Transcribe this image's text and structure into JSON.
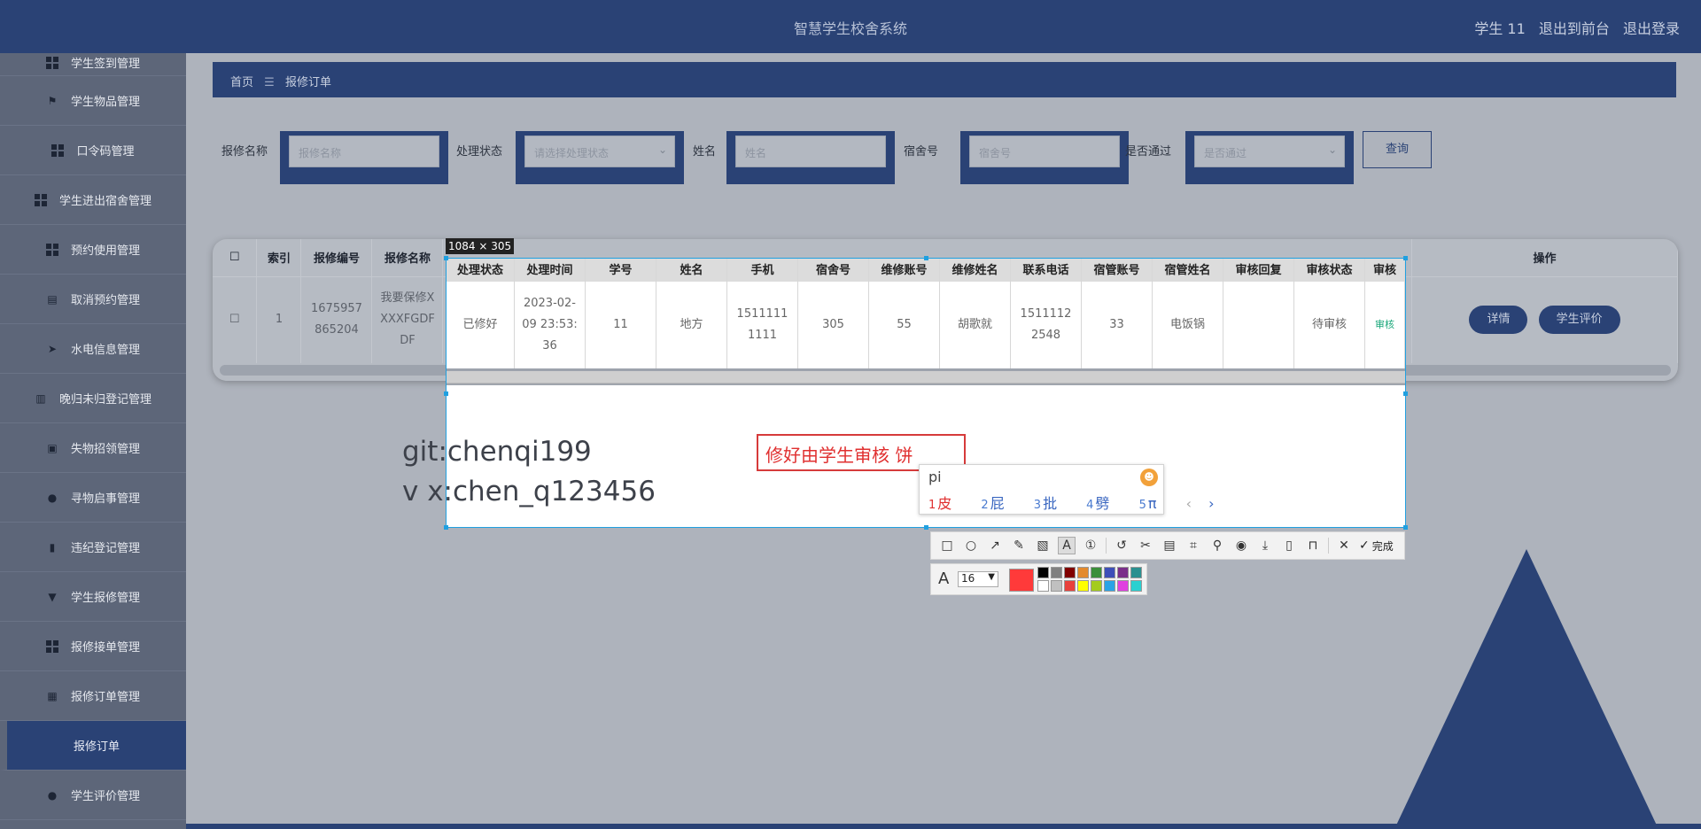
{
  "header": {
    "title": "智慧学生校舍系统",
    "user": "学生 11",
    "back_to_front": "退出到前台",
    "logout": "退出登录"
  },
  "sidebar": {
    "items": [
      {
        "label": "学生签到管理",
        "icon": "grid-icon"
      },
      {
        "label": "学生物品管理",
        "icon": "flag-icon"
      },
      {
        "label": "口令码管理",
        "icon": "grid-icon"
      },
      {
        "label": "学生进出宿舍管理",
        "icon": "grid-icon"
      },
      {
        "label": "预约使用管理",
        "icon": "grid-icon"
      },
      {
        "label": "取消预约管理",
        "icon": "clipboard-icon"
      },
      {
        "label": "水电信息管理",
        "icon": "send-icon"
      },
      {
        "label": "晚归未归登记管理",
        "icon": "book-icon"
      },
      {
        "label": "失物招领管理",
        "icon": "trash-icon"
      },
      {
        "label": "寻物启事管理",
        "icon": "user-icon"
      },
      {
        "label": "违纪登记管理",
        "icon": "bar-chart-icon"
      },
      {
        "label": "学生报修管理",
        "icon": "brush-icon"
      },
      {
        "label": "报修接单管理",
        "icon": "grid-icon"
      },
      {
        "label": "报修订单管理",
        "icon": "apps-icon"
      },
      {
        "label": "报修订单",
        "icon": ""
      },
      {
        "label": "学生评价管理",
        "icon": "user-icon"
      }
    ]
  },
  "breadcrumb": {
    "home": "首页",
    "sep": "☰",
    "current": "报修订单"
  },
  "filters": {
    "repair_name_label": "报修名称",
    "repair_name_placeholder": "报修名称",
    "status_label": "处理状态",
    "status_placeholder": "请选择处理状态",
    "name_label": "姓名",
    "name_placeholder": "姓名",
    "dorm_label": "宿舍号",
    "dorm_placeholder": "宿舍号",
    "pass_label": "是否通过",
    "pass_placeholder": "是否通过",
    "query_button": "查询"
  },
  "table": {
    "columns": [
      "索引",
      "报修编号",
      "报修名称",
      "处理状态",
      "处理时间",
      "学号",
      "姓名",
      "手机",
      "宿舍号",
      "维修账号",
      "维修姓名",
      "联系电话",
      "宿管账号",
      "宿管姓名",
      "审核回复",
      "审核状态",
      "审核",
      "操作"
    ],
    "row": {
      "index": "1",
      "repair_no": "1675957865204",
      "repair_name": "我要保修XXXXFGDF DF",
      "status": "已修好",
      "time": "2023-02-09 23:53:36",
      "student_no": "11",
      "name": "地方",
      "phone": "15111111111",
      "dorm": "305",
      "repair_account": "55",
      "repair_name_person": "胡歌就",
      "contact": "15111122548",
      "manager_account": "33",
      "manager_name": "电饭锅",
      "reply": "",
      "audit_status": "待审核",
      "audit": "审核",
      "detail_button": "详情",
      "evaluate_button": "学生评价"
    }
  },
  "capture": {
    "size_label": "1084 × 305"
  },
  "notes": {
    "line1": "git:chenqi199",
    "line2": "v x:chen_q123456"
  },
  "annotation": {
    "text": "修好由学生审核 饼"
  },
  "ime": {
    "input": "pi",
    "candidates": [
      {
        "num": "1",
        "text": "皮"
      },
      {
        "num": "2",
        "text": "屁"
      },
      {
        "num": "3",
        "text": "批"
      },
      {
        "num": "4",
        "text": "劈"
      },
      {
        "num": "5",
        "text": "π"
      }
    ]
  },
  "toolbar": {
    "done_label": "完成",
    "font_size": "16",
    "colors": {
      "selected": "#ff3a3a",
      "palette": [
        "#000000",
        "#808080",
        "#800000",
        "#e38a2e",
        "#3a8f3a",
        "#3d4fb8",
        "#7a2f8a",
        "#2a9090",
        "#ffffff",
        "#c0c0c0",
        "#e8413c",
        "#ffff00",
        "#a4cc1d",
        "#2aa3e6",
        "#e040e0",
        "#2ad0d0"
      ]
    }
  },
  "theme": {
    "primary": "#2a4275",
    "sidebar": "#5d6679",
    "overlay": "#aeb3bc"
  }
}
